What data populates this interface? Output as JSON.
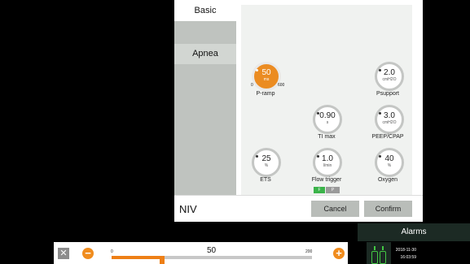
{
  "dialog": {
    "tabs": [
      {
        "label": "Basic"
      },
      {
        "label": "Apnea"
      }
    ],
    "mode_label": "NIV",
    "cancel_label": "Cancel",
    "confirm_label": "Confirm",
    "params": {
      "p_ramp": {
        "value": "50",
        "unit": "ms",
        "label": "P-ramp",
        "min_label": "0",
        "max_label": "600"
      },
      "psupport": {
        "value": "2.0",
        "unit": "cmH2O",
        "label": "Psupport"
      },
      "ti_max": {
        "value": "0.90",
        "unit": "s",
        "label": "TI max"
      },
      "peep": {
        "value": "3.0",
        "unit": "cmH2O",
        "label": "PEEP/CPAP"
      },
      "ets": {
        "value": "25",
        "unit": "%",
        "label": "ETS"
      },
      "flow_trigger": {
        "value": "1.0",
        "unit": "l/min",
        "label": "Flow trigger",
        "tag_f": "F",
        "tag_p": "P"
      },
      "oxygen": {
        "value": "40",
        "unit": "%",
        "label": "Oxygen"
      }
    }
  },
  "adjust_bar": {
    "min": "0",
    "max": "200",
    "value": "50",
    "value_num": 50,
    "range": [
      0,
      200
    ]
  },
  "alarms_label": "Alarms",
  "datetime": {
    "date": "2018-11-30",
    "time": "16:03:59"
  },
  "colors": {
    "accent": "#ee7f16",
    "panel": "#f0f2f0",
    "gas_ok": "#43c843"
  }
}
